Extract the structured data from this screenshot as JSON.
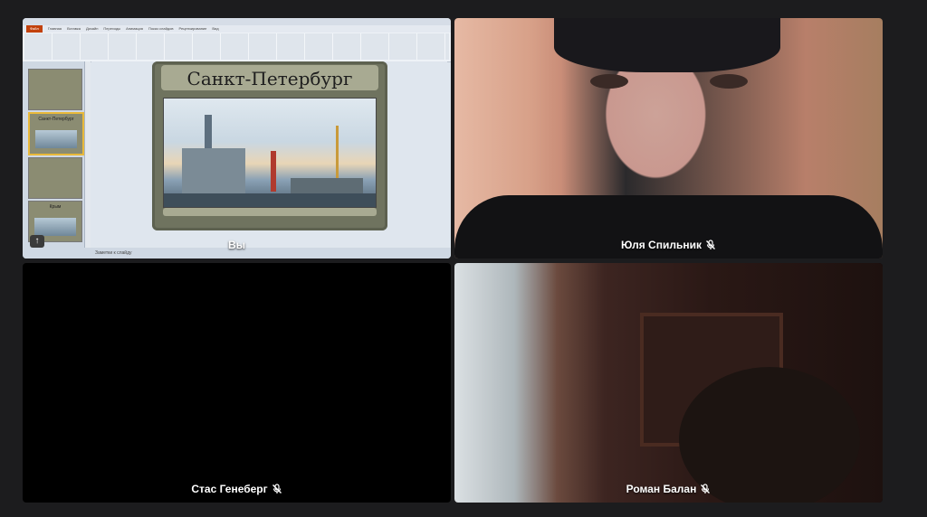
{
  "participants": [
    {
      "id": "you",
      "name": "Вы",
      "muted": false
    },
    {
      "id": "yulia",
      "name": "Юля Спильник",
      "muted": true
    },
    {
      "id": "stas",
      "name": "Стас Генеберг",
      "muted": true
    },
    {
      "id": "roman",
      "name": "Роман Балан",
      "muted": true
    }
  ],
  "shared_screen": {
    "app": "PowerPoint",
    "ribbon_tabs": [
      "Файл",
      "Главная",
      "Вставка",
      "Дизайн",
      "Переходы",
      "Анимация",
      "Показ слайдов",
      "Рецензирование",
      "Вид"
    ],
    "slide_title": "Санкт-Петербург",
    "thumbnails": [
      {
        "label": ""
      },
      {
        "label": "Санкт-Петербург"
      },
      {
        "label": ""
      },
      {
        "label": "Крым"
      }
    ],
    "notes_placeholder": "Заметки к слайду"
  },
  "colors": {
    "background": "#1c1c1e",
    "tile": "#000000",
    "label": "#ffffff",
    "ppt_accent": "#c2410c",
    "slide_frame": "#6f735f"
  },
  "icons": {
    "mic": "mic-off-icon",
    "upload": "arrow-up-icon"
  }
}
